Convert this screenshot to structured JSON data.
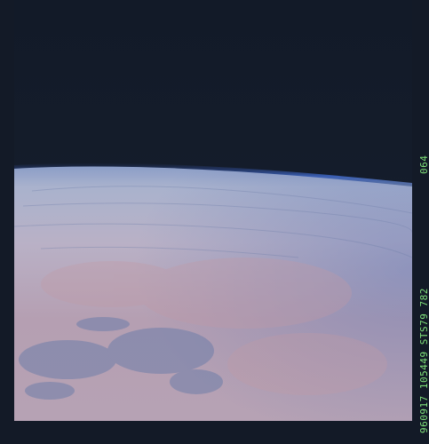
{
  "image": {
    "subject": "earth-limb-from-orbit",
    "colors": {
      "space": "#141b28",
      "atmosphere": "#3e63b3",
      "haze": "#aab3cd",
      "ground": "#b39fb0",
      "shadow": "#7c87ad",
      "film_text": "#7fe07a"
    }
  },
  "film_annotations": {
    "frame_number": "064",
    "data_strip": "960917 105449 STS79 782"
  }
}
